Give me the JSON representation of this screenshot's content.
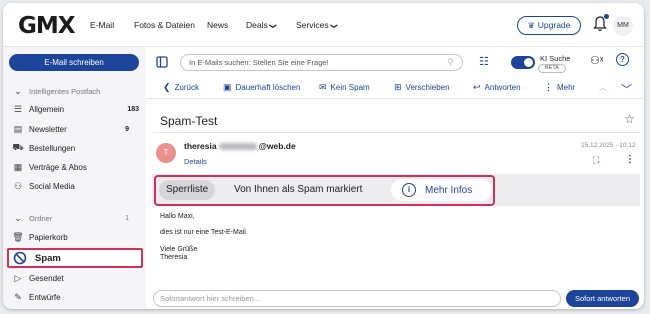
{
  "header": {
    "logo": "GMX",
    "nav": [
      {
        "label": "E-Mail"
      },
      {
        "label": "Fotos & Dateien"
      },
      {
        "label": "News"
      },
      {
        "label": "Deals"
      },
      {
        "label": "Services"
      }
    ],
    "nav_chevron": "❯",
    "upgrade_label": "Upgrade",
    "avatar_initials": "MM"
  },
  "sidebar": {
    "compose_label": "E-Mail schreiben",
    "smart_inbox": {
      "label": "Intelligentes Postfach"
    },
    "smart_items": [
      {
        "label": "Allgemein",
        "count": "183",
        "icon": "list-icon"
      },
      {
        "label": "Newsletter",
        "count": "9",
        "icon": "newsletter-icon"
      },
      {
        "label": "Bestellungen",
        "count": "",
        "icon": "cart-icon"
      },
      {
        "label": "Verträge & Abos",
        "count": "",
        "icon": "contract-icon"
      },
      {
        "label": "Social Media",
        "count": "",
        "icon": "social-icon"
      }
    ],
    "folders": {
      "label": "Ordner",
      "count": "1"
    },
    "folder_items": [
      {
        "label": "Papierkorb",
        "icon": "trash-icon"
      },
      {
        "label": "Spam",
        "icon": "spam-icon"
      },
      {
        "label": "Gesendet",
        "icon": "sent-icon"
      },
      {
        "label": "Entwürfe",
        "icon": "drafts-icon"
      }
    ]
  },
  "search": {
    "placeholder": "In E-Mails suchen: Stellen Sie eine Frage!",
    "ai_label": "KI Suche",
    "beta_label": "BETA"
  },
  "actions": {
    "back": "Zurück",
    "delete": "Dauerhaft löschen",
    "not_spam": "Kein Spam",
    "move": "Verschieben",
    "reply": "Antworten",
    "more": "Mehr"
  },
  "message": {
    "subject": "Spam-Test",
    "avatar_initial": "T",
    "sender_prefix": "theresia",
    "sender_domain": "@web.de",
    "details_label": "Details",
    "date": "15.12.2025 - 10:12",
    "spam_chip": "Sperrliste",
    "spam_notice": "Von Ihnen als Spam markiert",
    "more_info": "Mehr Infos",
    "body": {
      "greeting": "Hallo Maxi,",
      "line1": "dies ist nur eine Test-E-Mail.",
      "closing": "Viele Grüße",
      "signature": "Theresia"
    }
  },
  "reply": {
    "placeholder": "Sofortantwort hier schreiben...",
    "send_label": "Sofort antworten"
  },
  "colors": {
    "primary": "#1c449b",
    "highlight": "#d32f5a",
    "avatar": "#ec8f8f"
  }
}
